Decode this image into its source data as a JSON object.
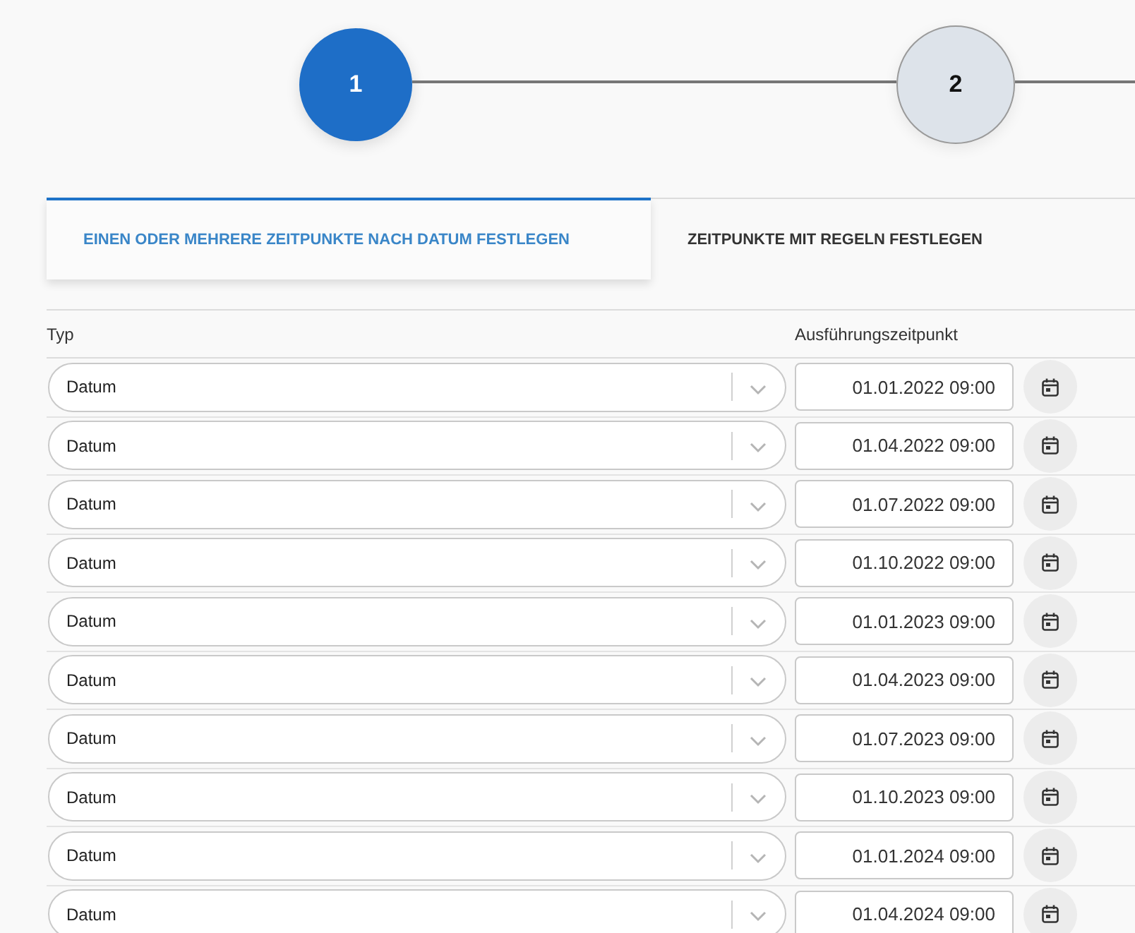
{
  "steps": [
    {
      "label": "1",
      "selected": true
    },
    {
      "label": "2",
      "selected": false
    }
  ],
  "tabs": [
    {
      "label": "EINEN ODER MEHRERE ZEITPUNKTE NACH DATUM FESTLEGEN",
      "selected": true
    },
    {
      "label": "ZEITPUNKTE MIT REGELN FESTLEGEN",
      "selected": false
    }
  ],
  "table": {
    "columns": [
      "Typ",
      "Ausführungszeitpunkt"
    ],
    "rows": [
      {
        "type": "Datum",
        "datetime": "01.01.2022 09:00"
      },
      {
        "type": "Datum",
        "datetime": "01.04.2022 09:00"
      },
      {
        "type": "Datum",
        "datetime": "01.07.2022 09:00"
      },
      {
        "type": "Datum",
        "datetime": "01.10.2022 09:00"
      },
      {
        "type": "Datum",
        "datetime": "01.01.2023 09:00"
      },
      {
        "type": "Datum",
        "datetime": "01.04.2023 09:00"
      },
      {
        "type": "Datum",
        "datetime": "01.07.2023 09:00"
      },
      {
        "type": "Datum",
        "datetime": "01.10.2023 09:00"
      },
      {
        "type": "Datum",
        "datetime": "01.01.2024 09:00"
      },
      {
        "type": "Datum",
        "datetime": "01.04.2024 09:00"
      }
    ]
  }
}
